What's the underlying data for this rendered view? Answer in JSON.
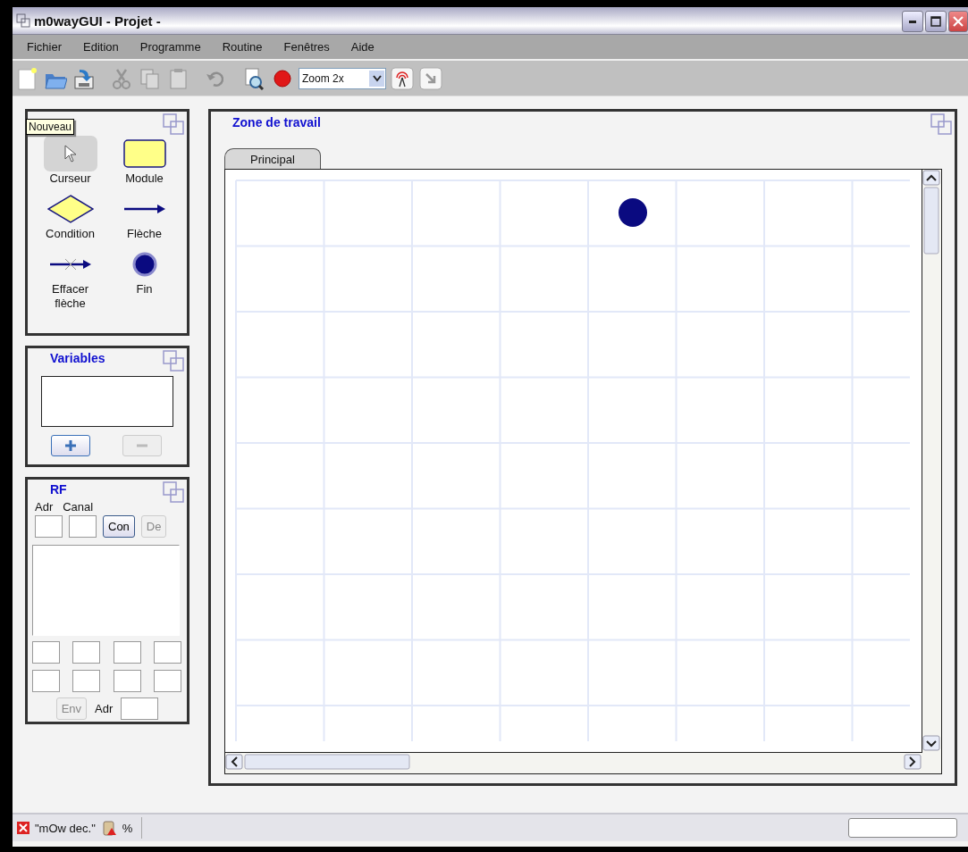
{
  "window": {
    "title": "m0wayGUI - Projet -"
  },
  "menu": [
    "Fichier",
    "Edition",
    "Programme",
    "Routine",
    "Fenêtres",
    "Aide"
  ],
  "toolbar": [
    {
      "kind": "new",
      "disabled": false
    },
    {
      "kind": "open",
      "disabled": false
    },
    {
      "kind": "save",
      "disabled": false
    },
    {
      "kind": "sep"
    },
    {
      "kind": "cut",
      "disabled": true
    },
    {
      "kind": "copy",
      "disabled": true
    },
    {
      "kind": "paste",
      "disabled": true
    },
    {
      "kind": "sep"
    },
    {
      "kind": "undo",
      "disabled": true
    },
    {
      "kind": "sep"
    },
    {
      "kind": "preview",
      "disabled": false
    },
    {
      "kind": "record",
      "disabled": false
    },
    {
      "kind": "zoom",
      "value": "Zoom 2x"
    },
    {
      "kind": "radio",
      "disabled": false
    },
    {
      "kind": "send",
      "disabled": false
    }
  ],
  "tooltip": "Nouveau",
  "tools_panel": {
    "items": [
      {
        "kind": "cursor",
        "label": "Curseur",
        "selected": true
      },
      {
        "kind": "module",
        "label": "Module",
        "selected": false
      },
      {
        "kind": "condition",
        "label": "Condition",
        "selected": false
      },
      {
        "kind": "arrow",
        "label": "Flèche",
        "selected": false
      },
      {
        "kind": "erase-arrow",
        "label": "Effacer flèche",
        "selected": false
      },
      {
        "kind": "end",
        "label": "Fin",
        "selected": false
      }
    ]
  },
  "variables_panel": {
    "title": "Variables",
    "buttons": [
      {
        "kind": "add",
        "disabled": false
      },
      {
        "kind": "remove",
        "disabled": true
      }
    ]
  },
  "rf_panel": {
    "title": "RF",
    "address_label": "Adr",
    "channel_label": "Canal",
    "connect_button": {
      "label": "Con",
      "disabled": false
    },
    "disconnect_button": {
      "label": "De",
      "disabled": true
    },
    "send_button": {
      "label": "Env",
      "disabled": true
    },
    "send_address_label": "Adr"
  },
  "work_zone": {
    "title": "Zone de travail",
    "tabs": [
      {
        "label": "Principal",
        "selected": true
      }
    ],
    "nodes": [
      {
        "kind": "end"
      }
    ]
  },
  "status_bar": {
    "file": "\"mOw dec.\"",
    "percent": "%"
  }
}
